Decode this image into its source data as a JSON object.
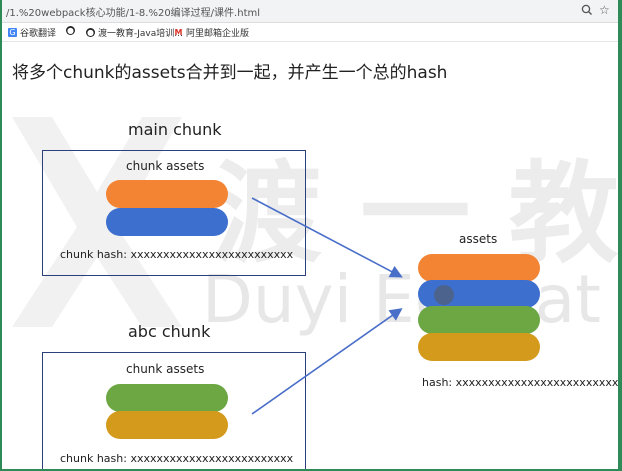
{
  "browser": {
    "url": "/1.%20webpack核心功能/1-8.%20编译过程/课件.html",
    "bookmarks": [
      {
        "label": "谷歌翻译",
        "icon": "translate-icon"
      },
      {
        "label": "",
        "icon": "github-icon"
      },
      {
        "label": "渡一教育-Java培训...",
        "icon": "github-icon"
      },
      {
        "label": "阿里邮箱企业版",
        "icon": "mail-icon"
      }
    ]
  },
  "slide": {
    "heading": "将多个chunk的assets合并到一起，并产生一个总的hash",
    "watermark_text": "Duyi Educat",
    "watermark_cn": "渡 一 教",
    "main_chunk": {
      "title": "main chunk",
      "assets_label": "chunk assets",
      "hash_label": "chunk hash: xxxxxxxxxxxxxxxxxxxxxxxxx"
    },
    "abc_chunk": {
      "title": "abc chunk",
      "assets_label": "chunk assets",
      "hash_label": "chunk hash: xxxxxxxxxxxxxxxxxxxxxxxxx"
    },
    "assets": {
      "title": "assets",
      "hash_label": "hash: xxxxxxxxxxxxxxxxxxxxxxxxx"
    }
  },
  "colors": {
    "orange": "#f28433",
    "blue": "#3d6fcf",
    "green": "#6da744",
    "gold": "#d49a1c",
    "box_border": "#2b3f7a",
    "arrow": "#4a6fc9"
  }
}
